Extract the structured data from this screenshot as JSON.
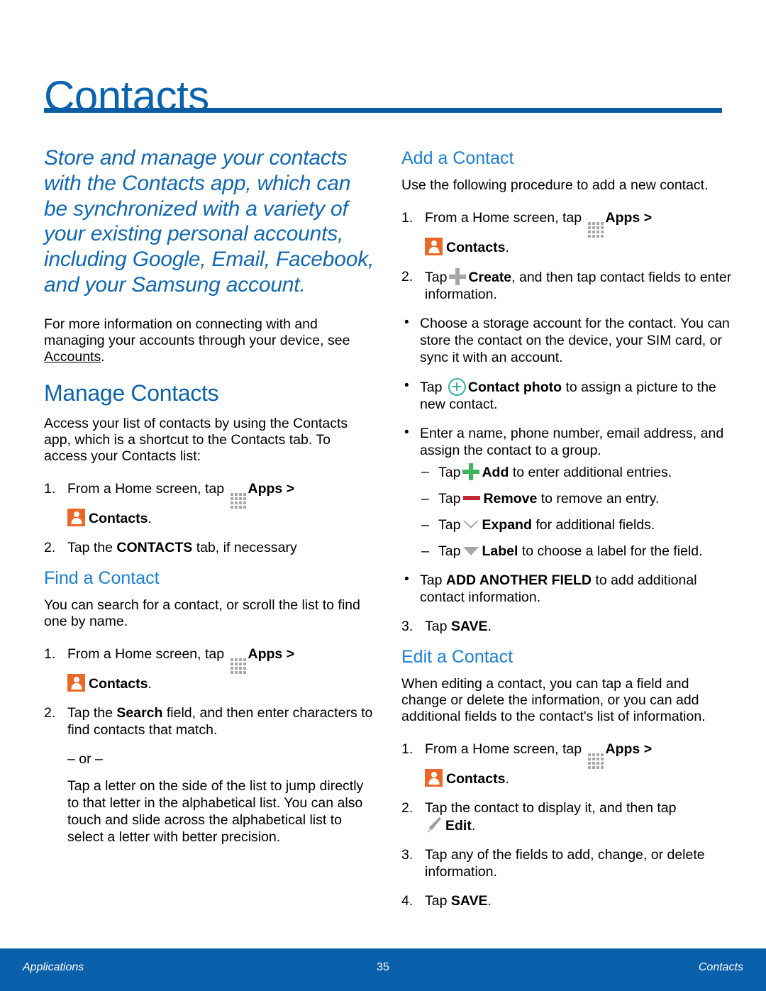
{
  "document": {
    "title": "Contacts",
    "accent_blue": "#0a63ad",
    "rule_blue": "#0a5da5",
    "heading_blue": "#1a7fd4",
    "orange": "#ec6826",
    "teal": "#2fb2a0",
    "green": "#3db35a",
    "red": "#c0282d",
    "gray": "#a6a6a6"
  },
  "left_column": {
    "lead": "Store and manage your contacts with the Contacts app, which can be synchronized with a variety of your existing personal accounts, including Google, Email, Facebook, and your Samsung account.",
    "intro_before_link": "For more information on connecting with and managing your accounts through your device, see ",
    "intro_link": "Accounts",
    "intro_after_link": ".",
    "manage_heading": "Manage Contacts",
    "manage_intro": "Access your list of contacts by using the Contacts app, which is a shortcut to the Contacts tab. To access your Contacts list:",
    "manage_steps": {
      "s1_num": "1.",
      "s1_a": "From a Home screen, tap",
      "s1_apps": "Apps",
      "s1_gt": ">",
      "s1_contacts": "Contacts",
      "s1_period": ".",
      "s2_num": "2.",
      "s2_a": "Tap the",
      "s2_b": "CONTACTS",
      "s2_c": "tab, if necessary"
    },
    "find_heading": "Find a Contact",
    "find_intro": "You can search for a contact, or scroll the list to find one by name.",
    "find_steps": {
      "s1_num": "1.",
      "s1_a": "From a Home screen, tap",
      "s1_apps": "Apps",
      "s1_gt": ">",
      "s1_contacts": "Contacts",
      "s1_period": ".",
      "s2_num": "2.",
      "s2_a": "Tap the",
      "s2_b": "Search",
      "s2_c": "field, and then enter characters to find contacts that match.",
      "or_divider": "– or –",
      "alt_text": "Tap a letter on the side of the list to jump directly to that letter in the alphabetical list. You can also touch and slide across the alphabetical list to select a letter with better precision."
    }
  },
  "right_column": {
    "add_heading": "Add a Contact",
    "add_intro": "Use the following procedure to add a new contact.",
    "add_steps": {
      "s1_num": "1.",
      "s1_a": "From a Home screen, tap",
      "s1_apps": "Apps",
      "s1_gt": ">",
      "s1_contacts": "Contacts",
      "s1_period": ".",
      "s2_num": "2.",
      "s2_a": "Tap",
      "s2_b": "Create",
      "s2_c": ", and then tap contact fields to enter information."
    },
    "add_bullets": {
      "b1": "Choose a storage account for the contact. You can store the contact on the device, your SIM card, or sync it with an account.",
      "b2_a": "Tap",
      "b2_b": "Contact photo",
      "b2_c": "to assign a picture to the new contact.",
      "b3": "Enter a name, phone number, email address, and assign the contact to a group.",
      "b4_a": "Tap",
      "b4_b": "ADD ANOTHER FIELD",
      "b4_c": "to add additional contact information."
    },
    "add_dashes": {
      "d1_a": "Tap",
      "d1_b": "Add",
      "d1_c": "to enter additional entries.",
      "d2_a": "Tap",
      "d2_b": "Remove",
      "d2_c": "to remove an entry.",
      "d3_a": "Tap",
      "d3_b": "Expand",
      "d3_c": "for additional fields.",
      "d4_a": "Tap",
      "d4_b": "Label",
      "d4_c": "to choose a label for the field."
    },
    "add_save": {
      "num": "3.",
      "a": "Tap",
      "b": "SAVE",
      "c": "."
    },
    "edit_heading": "Edit a Contact",
    "edit_intro": "When editing a contact, you can tap a field and change or delete the information, or you can add additional fields to the contact's list of information.",
    "edit_steps": {
      "s1_num": "1.",
      "s1_a": "From a Home screen, tap",
      "s1_apps": "Apps",
      "s1_gt": ">",
      "s1_contacts": "Contacts",
      "s1_period": ".",
      "s2_num": "2.",
      "s2_a": "Tap the contact to display it, and then tap",
      "s2_b": "Edit",
      "s2_c": ".",
      "s3_num": "3.",
      "s3_a": "Tap any of the fields to add, change, or delete information.",
      "s4_num": "4.",
      "s4_a": "Tap",
      "s4_b": "SAVE",
      "s4_c": "."
    }
  },
  "footer": {
    "left": "Applications",
    "page_number": "35",
    "right": "Contacts"
  }
}
